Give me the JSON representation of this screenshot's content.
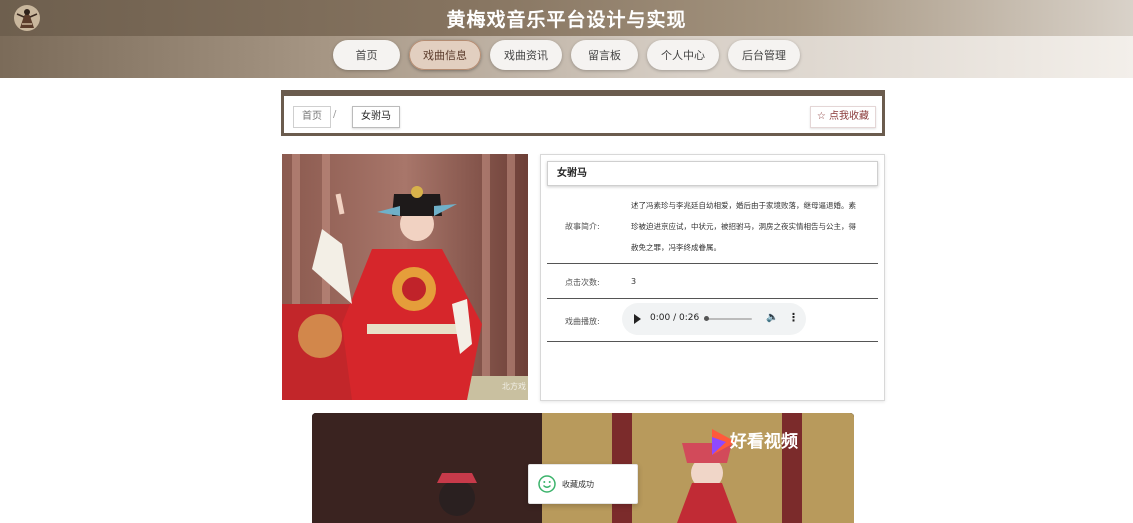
{
  "header": {
    "title": "黄梅戏音乐平台设计与实现",
    "logo_icon": "opera-figure-logo-icon"
  },
  "nav": {
    "items": [
      {
        "label": "首页"
      },
      {
        "label": "戏曲信息",
        "active": true
      },
      {
        "label": "戏曲资讯"
      },
      {
        "label": "留言板"
      },
      {
        "label": "个人中心"
      },
      {
        "label": "后台管理"
      }
    ]
  },
  "breadcrumb": {
    "home": "首页",
    "separator": "/",
    "current": "女驸马",
    "favorite_button": "☆ 点我收藏"
  },
  "opera": {
    "image_watermark": "北方戏",
    "title": "女驸马",
    "summary_label": "故事简介:",
    "summary": "述了冯素珍与李兆廷自幼相爱，婚后由于家境败落，继母逼退婚。素珍被迫进京应试，中状元，被招驸马，洞房之夜实情相告与公主，得赦免之罪，冯李终成眷属。",
    "clicks_label": "点击次数:",
    "clicks": "3",
    "play_label": "戏曲播放:",
    "audio": {
      "time": "0:00 / 0:26",
      "progress": 0
    }
  },
  "video": {
    "brand": "好看视频"
  },
  "toast": {
    "text": "收藏成功"
  },
  "colors": {
    "header_brown": "#6e5f4e",
    "frame_brown": "#6b5c4e",
    "active_tab": "#e2cfc0",
    "toast_green": "#3bb36b"
  }
}
